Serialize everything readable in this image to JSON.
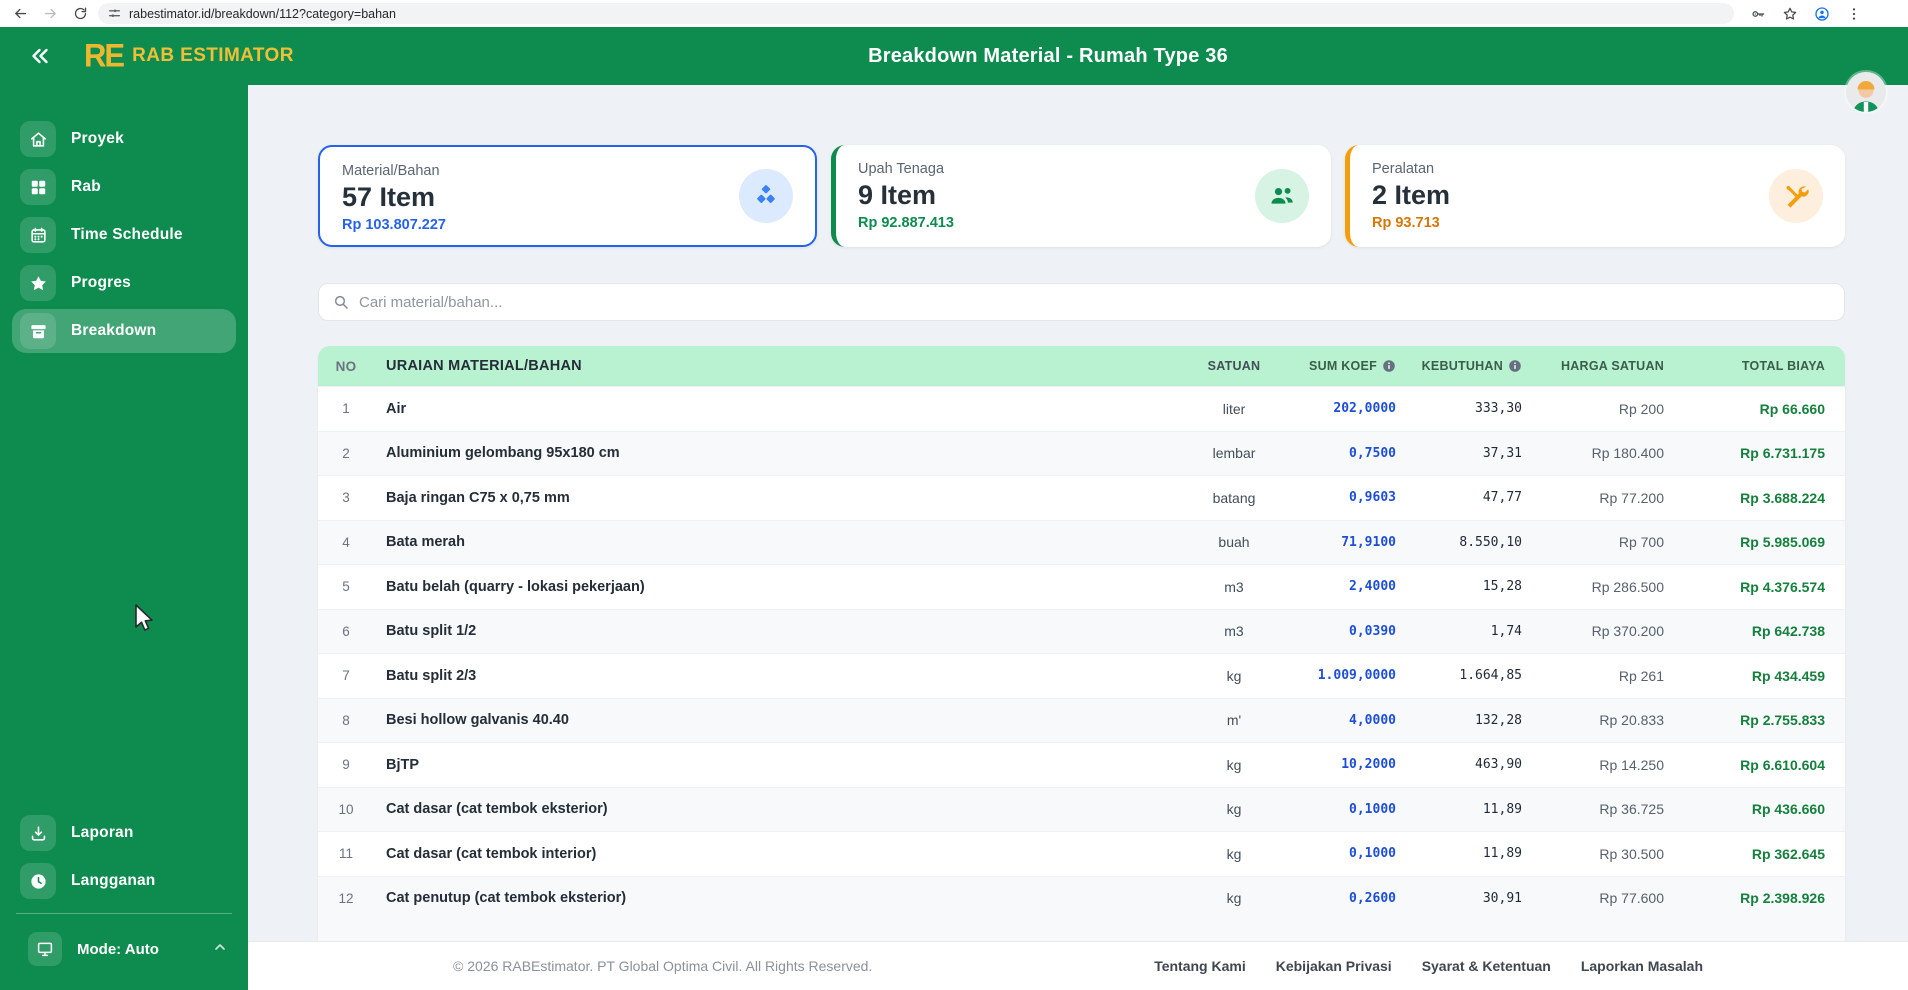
{
  "browser": {
    "url": "rabestimator.id/breakdown/112?category=bahan"
  },
  "header": {
    "brand_mark": "RE",
    "brand": "RAB ESTIMATOR",
    "title": "Breakdown Material - Rumah Type 36"
  },
  "sidebar": {
    "items": [
      {
        "label": "Proyek",
        "icon": "home-icon",
        "active": false
      },
      {
        "label": "Rab",
        "icon": "grid-icon",
        "active": false
      },
      {
        "label": "Time Schedule",
        "icon": "calendar-icon",
        "active": false
      },
      {
        "label": "Progres",
        "icon": "star-icon",
        "active": false
      },
      {
        "label": "Breakdown",
        "icon": "archive-icon",
        "active": true
      }
    ],
    "bottom_items": [
      {
        "label": "Laporan",
        "icon": "download-icon"
      },
      {
        "label": "Langganan",
        "icon": "clock-icon"
      }
    ],
    "mode": {
      "label": "Mode: Auto",
      "icon": "monitor-icon"
    }
  },
  "cards": [
    {
      "label": "Material/Bahan",
      "count": "57 Item",
      "amount": "Rp 103.807.227",
      "accent": "#2563eb",
      "icon": "cubes-icon",
      "selected": true
    },
    {
      "label": "Upah Tenaga",
      "count": "9 Item",
      "amount": "Rp 92.887.413",
      "accent": "#0e8c4f",
      "icon": "workers-icon",
      "selected": false
    },
    {
      "label": "Peralatan",
      "count": "2 Item",
      "amount": "Rp 93.713",
      "accent": "#f59e0b",
      "icon": "tools-icon",
      "selected": false
    }
  ],
  "search": {
    "placeholder": "Cari material/bahan..."
  },
  "table": {
    "columns": [
      "NO",
      "URAIAN MATERIAL/BAHAN",
      "SATUAN",
      "SUM KOEF",
      "KEBUTUHAN",
      "HARGA SATUAN",
      "TOTAL BIAYA"
    ],
    "info_columns": [
      "SUM KOEF",
      "KEBUTUHAN"
    ],
    "rows": [
      [
        "1",
        "Air",
        "liter",
        "202,0000",
        "333,30",
        "Rp 200",
        "Rp 66.660"
      ],
      [
        "2",
        "Aluminium gelombang 95x180 cm",
        "lembar",
        "0,7500",
        "37,31",
        "Rp 180.400",
        "Rp 6.731.175"
      ],
      [
        "3",
        "Baja ringan C75 x 0,75 mm",
        "batang",
        "0,9603",
        "47,77",
        "Rp 77.200",
        "Rp 3.688.224"
      ],
      [
        "4",
        "Bata merah",
        "buah",
        "71,9100",
        "8.550,10",
        "Rp 700",
        "Rp 5.985.069"
      ],
      [
        "5",
        "Batu belah (quarry - lokasi pekerjaan)",
        "m3",
        "2,4000",
        "15,28",
        "Rp 286.500",
        "Rp 4.376.574"
      ],
      [
        "6",
        "Batu split 1/2",
        "m3",
        "0,0390",
        "1,74",
        "Rp 370.200",
        "Rp 642.738"
      ],
      [
        "7",
        "Batu split 2/3",
        "kg",
        "1.009,0000",
        "1.664,85",
        "Rp 261",
        "Rp 434.459"
      ],
      [
        "8",
        "Besi hollow galvanis 40.40",
        "m'",
        "4,0000",
        "132,28",
        "Rp 20.833",
        "Rp 2.755.833"
      ],
      [
        "9",
        "BjTP",
        "kg",
        "10,2000",
        "463,90",
        "Rp 14.250",
        "Rp 6.610.604"
      ],
      [
        "10",
        "Cat dasar (cat tembok eksterior)",
        "kg",
        "0,1000",
        "11,89",
        "Rp 36.725",
        "Rp 436.660"
      ],
      [
        "11",
        "Cat dasar (cat tembok interior)",
        "kg",
        "0,1000",
        "11,89",
        "Rp 30.500",
        "Rp 362.645"
      ],
      [
        "12",
        "Cat penutup (cat tembok eksterior)",
        "kg",
        "0,2600",
        "30,91",
        "Rp 77.600",
        "Rp 2.398.926"
      ]
    ]
  },
  "footer": {
    "copyright": "© 2026 RABEstimator. PT Global Optima Civil. All Rights Reserved.",
    "links": [
      "Tentang Kami",
      "Kebijakan Privasi",
      "Syarat & Ketentuan",
      "Laporkan Masalah"
    ]
  },
  "colors": {
    "primary_green": "#0e8c4f",
    "table_header_green": "#b9f2d0",
    "brand_gold": "#edb72f",
    "selected_blue": "#2563eb",
    "koef_blue": "#1d4ed8",
    "total_green": "#15803d",
    "tools_orange": "#f59e0b"
  }
}
